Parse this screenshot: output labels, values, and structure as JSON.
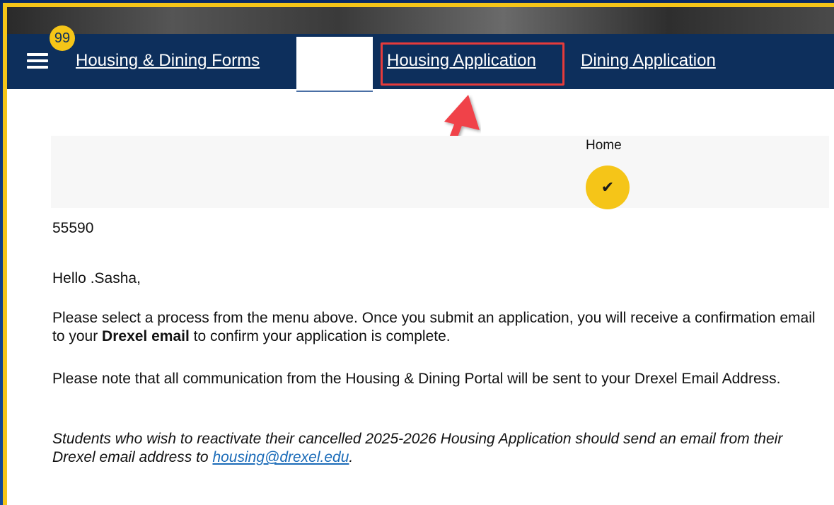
{
  "badge": {
    "count": "99"
  },
  "nav": {
    "forms_label": "Housing & Dining Forms",
    "housing_label": "Housing Application",
    "dining_label": "Dining Application"
  },
  "progress": {
    "step_label": "Home",
    "step_icon": "✔"
  },
  "content": {
    "id_number": "55590",
    "greeting": "Hello .Sasha,",
    "para1_before": "Please select a process from the menu above. Once you submit an application, you will receive a confirmation email to your ",
    "para1_bold": "Drexel email",
    "para1_after": " to confirm your application is complete.",
    "para2": "Please note that all communication from the Housing & Dining Portal will be sent to your Drexel Email Address.",
    "para3_before": "Students who wish to reactivate their cancelled 2025-2026 Housing Application should send an email from their Drexel email address to ",
    "para3_link": "housing@drexel.edu",
    "para3_after": "."
  },
  "colors": {
    "nav_bg": "#0d2f5c",
    "accent_yellow": "#f5c518",
    "highlight_red": "#e53b3b",
    "link_blue": "#1a6bb8"
  }
}
